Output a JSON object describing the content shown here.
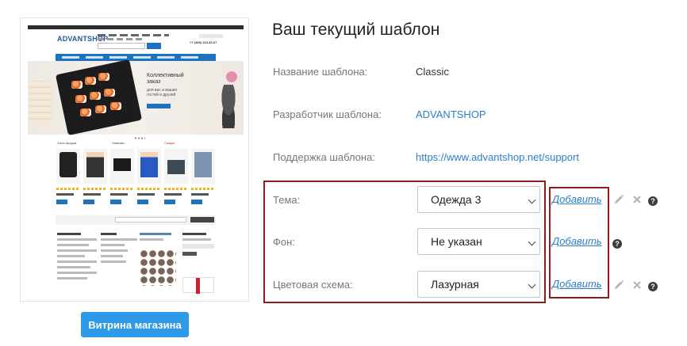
{
  "preview": {
    "logo": "ADVANTSHOP",
    "phone": "+7 (495) 123-45-67",
    "banner_title_1": "Коллективный",
    "banner_title_2": "заказ",
    "banner_sub_1": "для вас и ваших",
    "banner_sub_2": "гостей и друзей",
    "section_1": "Хиты продаж",
    "section_2": "Новинки",
    "section_3": "Скидки"
  },
  "showcase_button": "Витрина магазина",
  "title": "Ваш текущий шаблон",
  "info": {
    "name_label": "Название шаблона:",
    "name_value": "Classic",
    "developer_label": "Разработчик шаблона:",
    "developer_value": "ADVANTSHOP",
    "support_label": "Поддержка шаблона:",
    "support_value": "https://www.advantshop.net/support"
  },
  "settings": {
    "theme": {
      "label": "Тема:",
      "value": "Одежда 3",
      "add": "Добавить"
    },
    "background": {
      "label": "Фон:",
      "value": "Не указан",
      "add": "Добавить"
    },
    "color_scheme": {
      "label": "Цветовая схема:",
      "value": "Лазурная",
      "add": "Добавить"
    }
  },
  "icons": {
    "edit": "pencil-icon",
    "delete": "close-icon",
    "help": "question-icon",
    "help_glyph": "?"
  },
  "colors": {
    "accent": "#2f9ae8",
    "link": "#2a7fc9",
    "highlight_border": "#8b1d1d"
  }
}
